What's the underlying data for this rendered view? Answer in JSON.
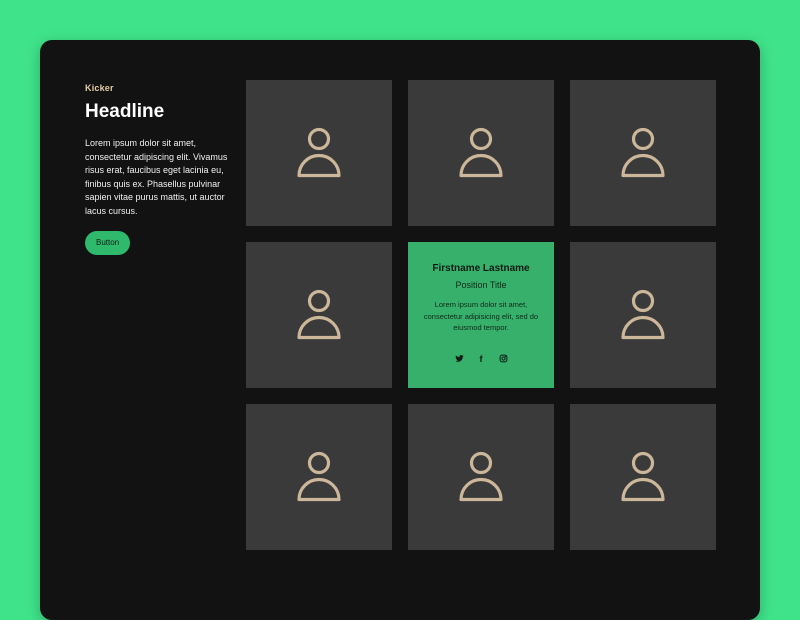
{
  "intro": {
    "kicker": "Kicker",
    "headline": "Headline",
    "body": "Lorem ipsum dolor sit amet, consectetur adipiscing elit. Vivamus risus erat, faucibus eget lacinia eu, finibus quis ex. Phasellus pulvinar sapien vitae purus mattis, ut auctor lacus cursus.",
    "button_label": "Button"
  },
  "team_card": {
    "name": "Firstname Lastname",
    "position": "Position Title",
    "bio": "Lorem ipsum dolor sit amet, consectetur adipisicing elit, sed do eiusmod tempor.",
    "social": {
      "twitter_icon": "twitter-icon",
      "facebook_icon": "facebook-icon",
      "facebook_glyph": "f",
      "instagram_icon": "instagram-icon"
    }
  },
  "grid": {
    "tile_icon": "user-icon",
    "tile_count": 9,
    "active_tile": 5
  },
  "colors": {
    "background": "#3fe38a",
    "panel": "#121212",
    "tile": "#3a3a3a",
    "active_tile": "#36b06a",
    "icon_stroke": "#ccb79a",
    "kicker": "#e3cba7",
    "button": "#2fb96c"
  }
}
